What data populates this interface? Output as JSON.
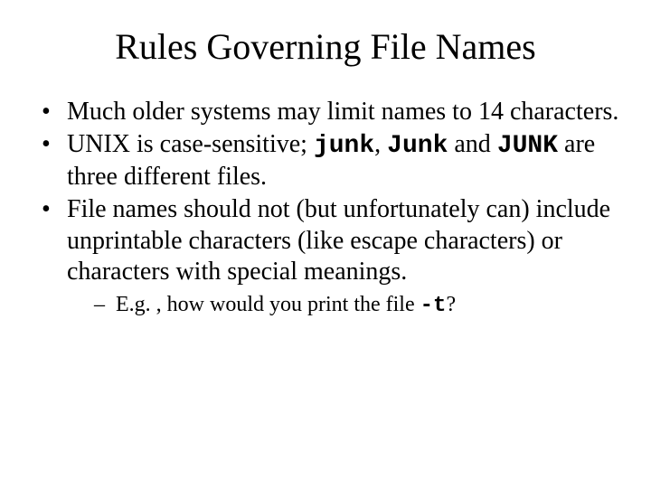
{
  "title": "Rules Governing File Names",
  "bullet1": "Much older systems may limit names to 14 characters.",
  "bullet2": {
    "pre": "UNIX is case-sensitive; ",
    "code1": "junk",
    "sep1": ", ",
    "code2": "Junk",
    "mid": " and ",
    "code3": "JUNK",
    "post": " are three different files."
  },
  "bullet3": "File names should not (but unfortunately can) include unprintable characters (like escape characters) or characters with special meanings.",
  "sub1": {
    "pre": "E.g. , how would you print the file ",
    "code": "-t",
    "post": "?"
  }
}
